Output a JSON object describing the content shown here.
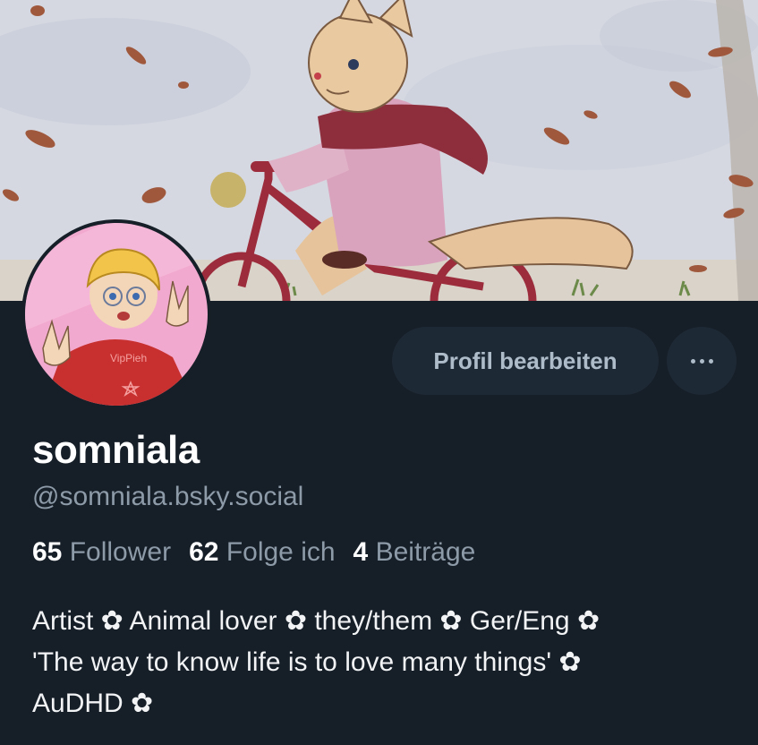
{
  "profile": {
    "display_name": "somniala",
    "handle": "@somniala.bsky.social",
    "edit_label": "Profil bearbeiten",
    "more_icon": "ellipsis-icon",
    "stats": {
      "followers_count": "65",
      "followers_label": "Follower",
      "following_count": "62",
      "following_label": "Folge ich",
      "posts_count": "4",
      "posts_label": "Beiträge"
    },
    "bio_lines": [
      "Artist ✿ Animal lover ✿ they/them ✿ Ger/Eng ✿",
      "'The way to know life is to love many things' ✿",
      "AuDHD ✿"
    ]
  },
  "colors": {
    "background": "#161e27",
    "button_bg": "#1e2936",
    "muted_text": "#8d9aa8",
    "button_text": "#aebbc9"
  },
  "banner": {
    "subject": "watercolor cat on red bicycle with falling leaves"
  },
  "avatar": {
    "subject": "cartoon person with blonde hair and glasses doing peace signs"
  }
}
